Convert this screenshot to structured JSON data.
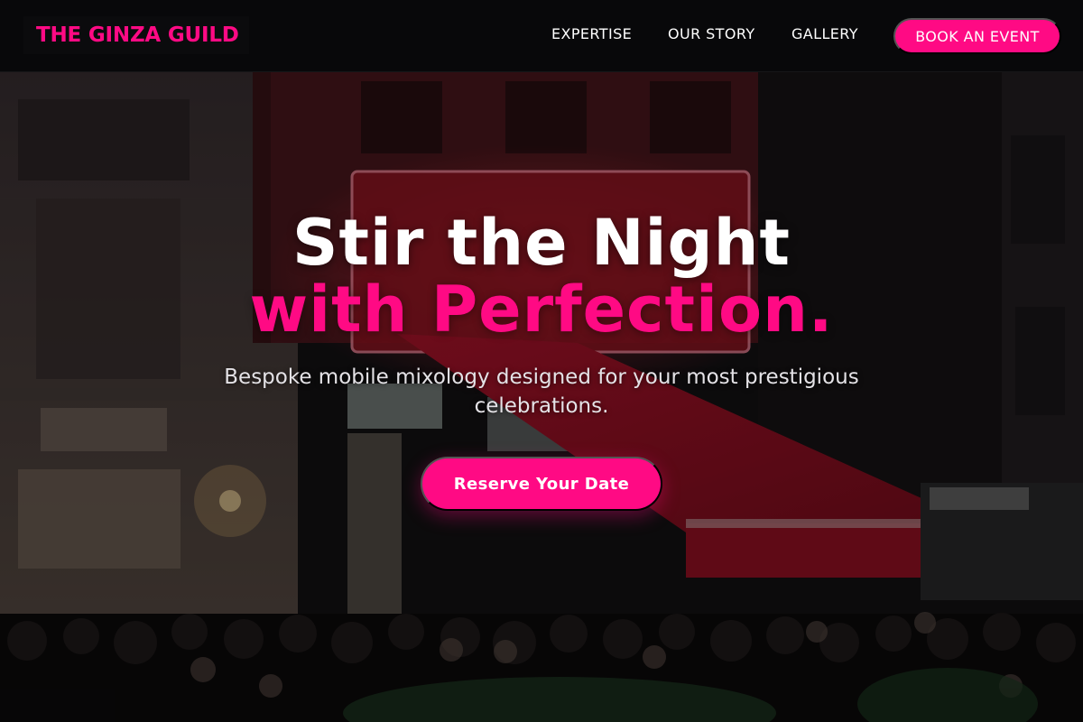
{
  "header": {
    "logo_text": "THE GINZA GUILD",
    "nav": [
      "EXPERTISE",
      "OUR STORY",
      "GALLERY"
    ],
    "cta_label": "BOOK AN EVENT"
  },
  "hero": {
    "title_line1": "Stir the Night",
    "title_line2": "with Perfection.",
    "subtitle": "Bespoke mobile mixology designed for your most prestigious celebrations.",
    "cta_label": "Reserve Your Date",
    "background": "night-street-bar-crowd-photo"
  },
  "colors": {
    "accent": "#ff0a84",
    "header_bg": "#08080a",
    "text_light": "#ffffff"
  }
}
